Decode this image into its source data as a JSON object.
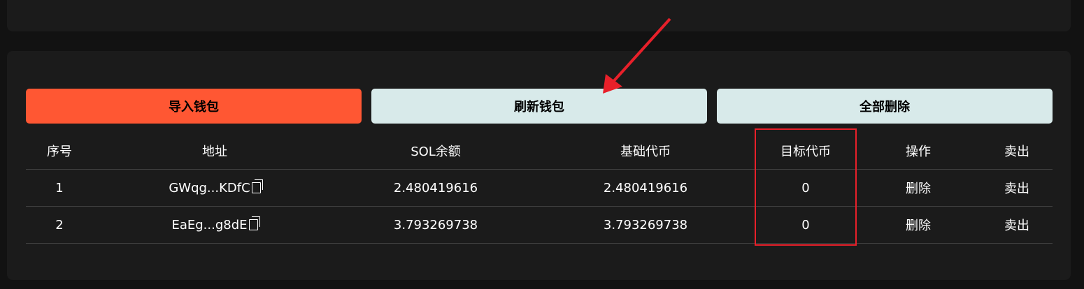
{
  "buttons": {
    "import": "导入钱包",
    "refresh": "刷新钱包",
    "delete_all": "全部删除"
  },
  "colors": {
    "accent": "#ff5733",
    "secondary": "#d8eaea",
    "annotation": "#e8202a"
  },
  "table": {
    "headers": [
      "序号",
      "地址",
      "SOL余额",
      "基础代币",
      "目标代币",
      "操作",
      "卖出"
    ],
    "rows": [
      {
        "index": "1",
        "address": "GWqg...KDfC",
        "sol": "2.480419616",
        "base": "2.480419616",
        "target": "0",
        "delete": "删除",
        "sell": "卖出"
      },
      {
        "index": "2",
        "address": "EaEg...g8dE",
        "sol": "3.793269738",
        "base": "3.793269738",
        "target": "0",
        "delete": "删除",
        "sell": "卖出"
      }
    ]
  }
}
